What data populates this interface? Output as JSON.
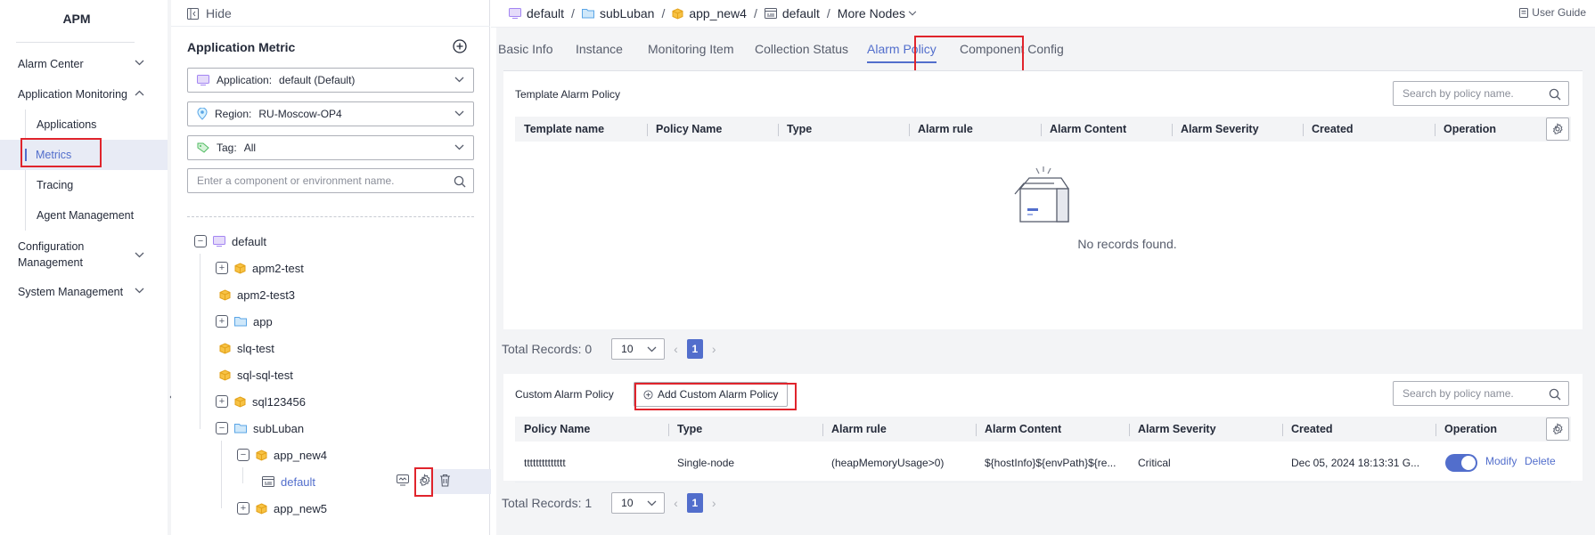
{
  "nav": {
    "title": "APM",
    "items": [
      {
        "label": "Alarm Center"
      },
      {
        "label": "Application Monitoring"
      },
      {
        "label": "Configuration Management"
      },
      {
        "label": "System Management"
      }
    ],
    "sub_items": [
      {
        "label": "Applications"
      },
      {
        "label": "Metrics"
      },
      {
        "label": "Tracing"
      },
      {
        "label": "Agent Management"
      }
    ]
  },
  "panel": {
    "hide_label": "Hide",
    "title": "Application Metric",
    "application_label": "Application:",
    "application_value": "default (Default)",
    "region_label": "Region:",
    "region_value": "RU-Moscow-OP4",
    "tag_label": "Tag:",
    "tag_value": "All",
    "search_placeholder": "Enter a component or environment name.",
    "tree": [
      {
        "label": "default"
      },
      {
        "label": "apm2-test"
      },
      {
        "label": "apm2-test3"
      },
      {
        "label": "app"
      },
      {
        "label": "slq-test"
      },
      {
        "label": "sql-sql-test"
      },
      {
        "label": "sql123456"
      },
      {
        "label": "subLuban"
      },
      {
        "label": "app_new4"
      },
      {
        "label": "default"
      },
      {
        "label": "app_new5"
      }
    ]
  },
  "breadcrumb": {
    "items": [
      "default",
      "subLuban",
      "app_new4",
      "default",
      "More Nodes"
    ],
    "separator": "/"
  },
  "user_guide": "User Guide",
  "tabs": [
    "Basic Info",
    "Instance",
    "Monitoring Item",
    "Collection Status",
    "Alarm Policy",
    "Component Config"
  ],
  "template_section": {
    "title": "Template Alarm Policy",
    "search_placeholder": "Search by policy name.",
    "columns": [
      "Template name",
      "Policy Name",
      "Type",
      "Alarm rule",
      "Alarm Content",
      "Alarm Severity",
      "Created",
      "Operation"
    ],
    "empty_text": "No records found.",
    "total": "Total Records: 0",
    "page_size": "10",
    "page": "1"
  },
  "custom_section": {
    "title": "Custom Alarm Policy",
    "add_button": "Add Custom Alarm Policy",
    "search_placeholder": "Search by policy name.",
    "columns": [
      "Policy Name",
      "Type",
      "Alarm rule",
      "Alarm Content",
      "Alarm Severity",
      "Created",
      "Operation"
    ],
    "rows": [
      {
        "policy_name": "tttttttttttttt",
        "type": "Single-node",
        "alarm_rule": "(heapMemoryUsage>0)",
        "alarm_content": "${hostInfo}${envPath}${re...",
        "severity": "Critical",
        "created": "Dec 05, 2024 18:13:31 G...",
        "enabled": true,
        "modify": "Modify",
        "delete": "Delete"
      }
    ],
    "total": "Total Records: 1",
    "page_size": "10",
    "page": "1"
  },
  "colors": {
    "accent": "#526ecc",
    "highlight": "#e0242c",
    "bg": "#f3f4f6"
  }
}
